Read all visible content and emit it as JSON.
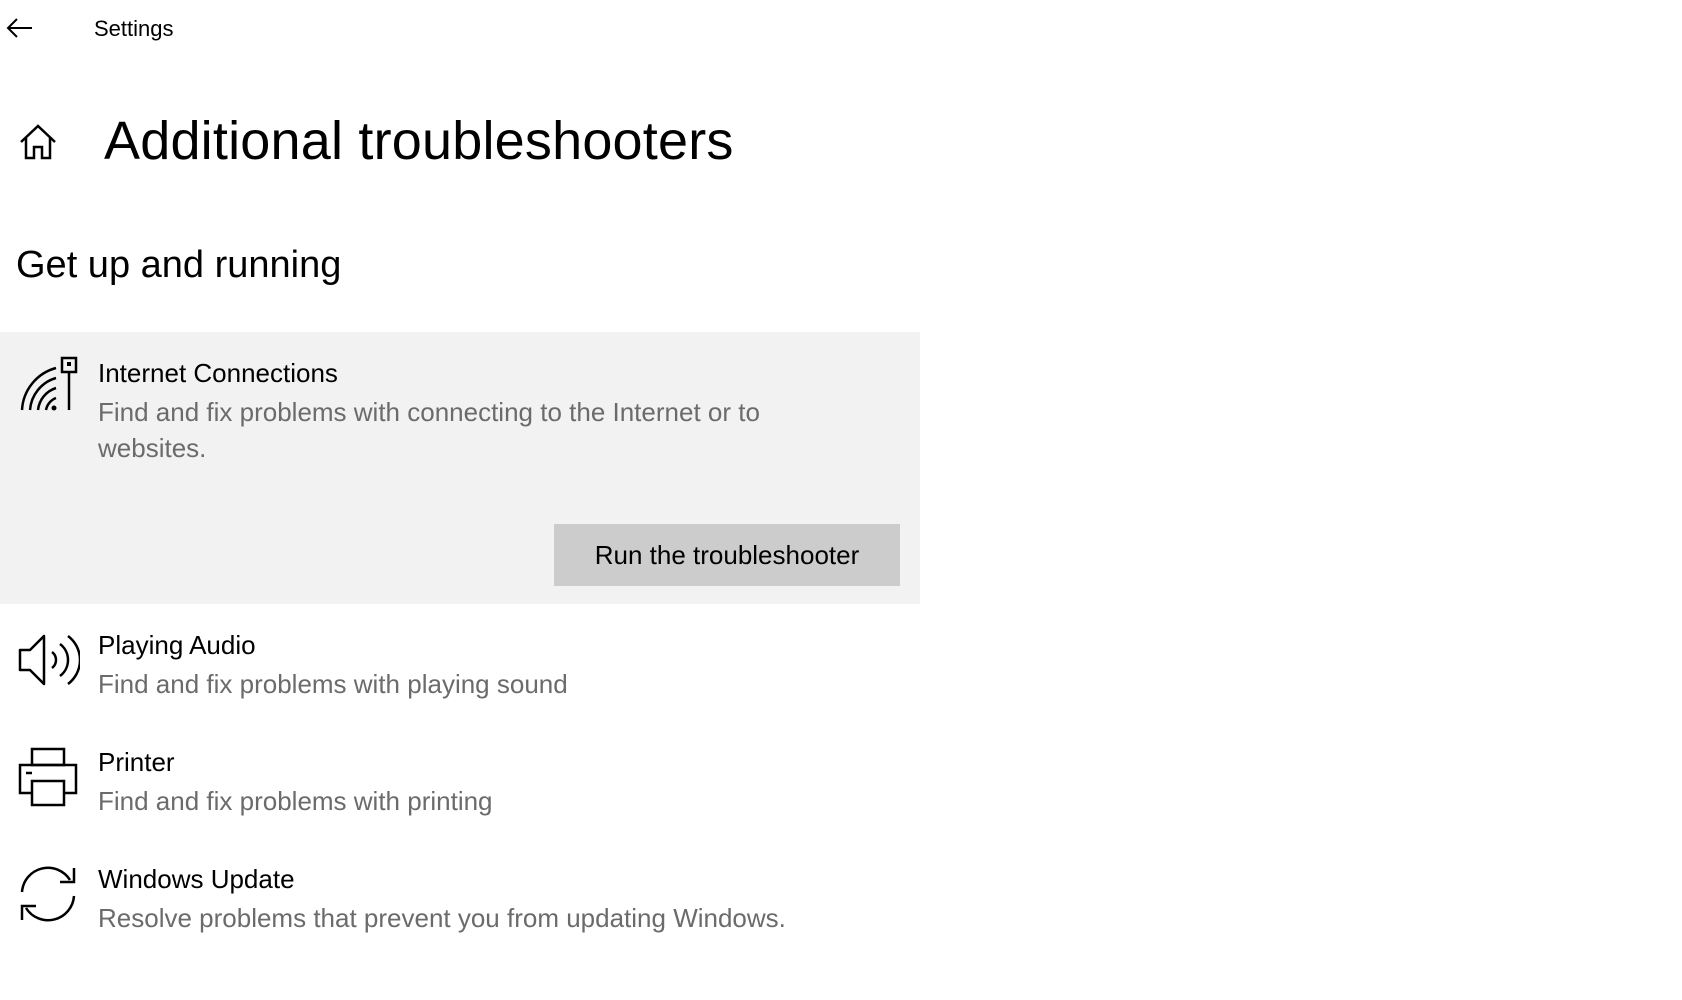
{
  "window": {
    "app_title": "Settings"
  },
  "header": {
    "page_title": "Additional troubleshooters"
  },
  "section": {
    "title": "Get up and running"
  },
  "troubleshooters": [
    {
      "title": "Internet Connections",
      "description": "Find and fix problems with connecting to the Internet or to websites.",
      "icon": "network-signal-icon",
      "expanded": true,
      "action_label": "Run the troubleshooter"
    },
    {
      "title": "Playing Audio",
      "description": "Find and fix problems with playing sound",
      "icon": "speaker-icon",
      "expanded": false
    },
    {
      "title": "Printer",
      "description": "Find and fix problems with printing",
      "icon": "printer-icon",
      "expanded": false
    },
    {
      "title": "Windows Update",
      "description": "Resolve problems that prevent you from updating Windows.",
      "icon": "sync-icon",
      "expanded": false
    }
  ],
  "colors": {
    "expanded_background": "#f2f2f2",
    "button_background": "#cccccc",
    "description_text": "#6b6b6b"
  }
}
